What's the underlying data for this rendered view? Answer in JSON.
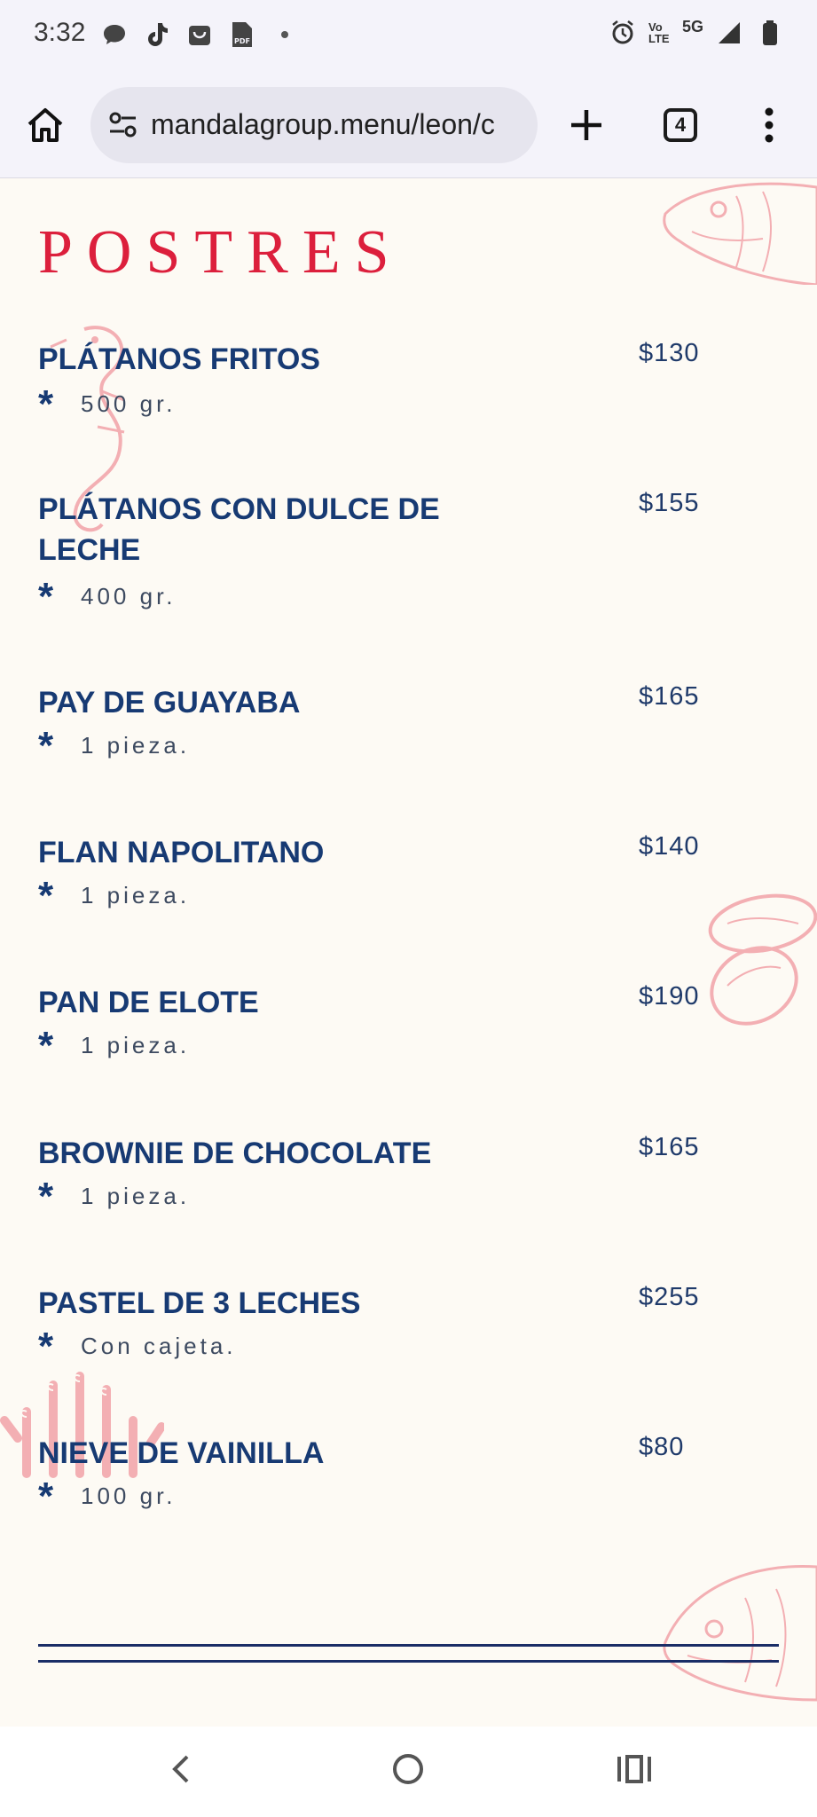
{
  "status_bar": {
    "time": "3:32",
    "left_icons": [
      "chat-icon",
      "tiktok-icon",
      "shop-icon",
      "pdf-icon",
      "dot-icon"
    ],
    "right_icons": [
      "alarm-icon",
      "volte-icon",
      "5g-icon",
      "signal-icon",
      "battery-icon"
    ],
    "network": "5G",
    "volte": "Vo LTE"
  },
  "browser": {
    "url": "mandalagroup.menu/leon/c",
    "tab_count": "4"
  },
  "menu": {
    "section_title": "POSTRES",
    "items": [
      {
        "name": "PLÁTANOS FRITOS",
        "price": "$130",
        "desc": "500 gr."
      },
      {
        "name": "PLÁTANOS CON DULCE DE LECHE",
        "price": "$155",
        "desc": "400 gr."
      },
      {
        "name": "PAY DE GUAYABA",
        "price": "$165",
        "desc": "1 pieza."
      },
      {
        "name": "FLAN NAPOLITANO",
        "price": "$140",
        "desc": "1 pieza."
      },
      {
        "name": "PAN DE ELOTE",
        "price": "$190",
        "desc": "1 pieza."
      },
      {
        "name": "BROWNIE DE CHOCOLATE",
        "price": "$165",
        "desc": "1 pieza."
      },
      {
        "name": "PASTEL DE 3 LECHES",
        "price": "$255",
        "desc": "Con cajeta."
      },
      {
        "name": "NIEVE DE VAINILLA",
        "price": "$80",
        "desc": "100 gr."
      }
    ],
    "bullet": "*"
  },
  "colors": {
    "title_red": "#dc1f3c",
    "item_blue": "#173a73",
    "background": "#fdfaf4",
    "decoration_pink": "#f2a7ad"
  }
}
